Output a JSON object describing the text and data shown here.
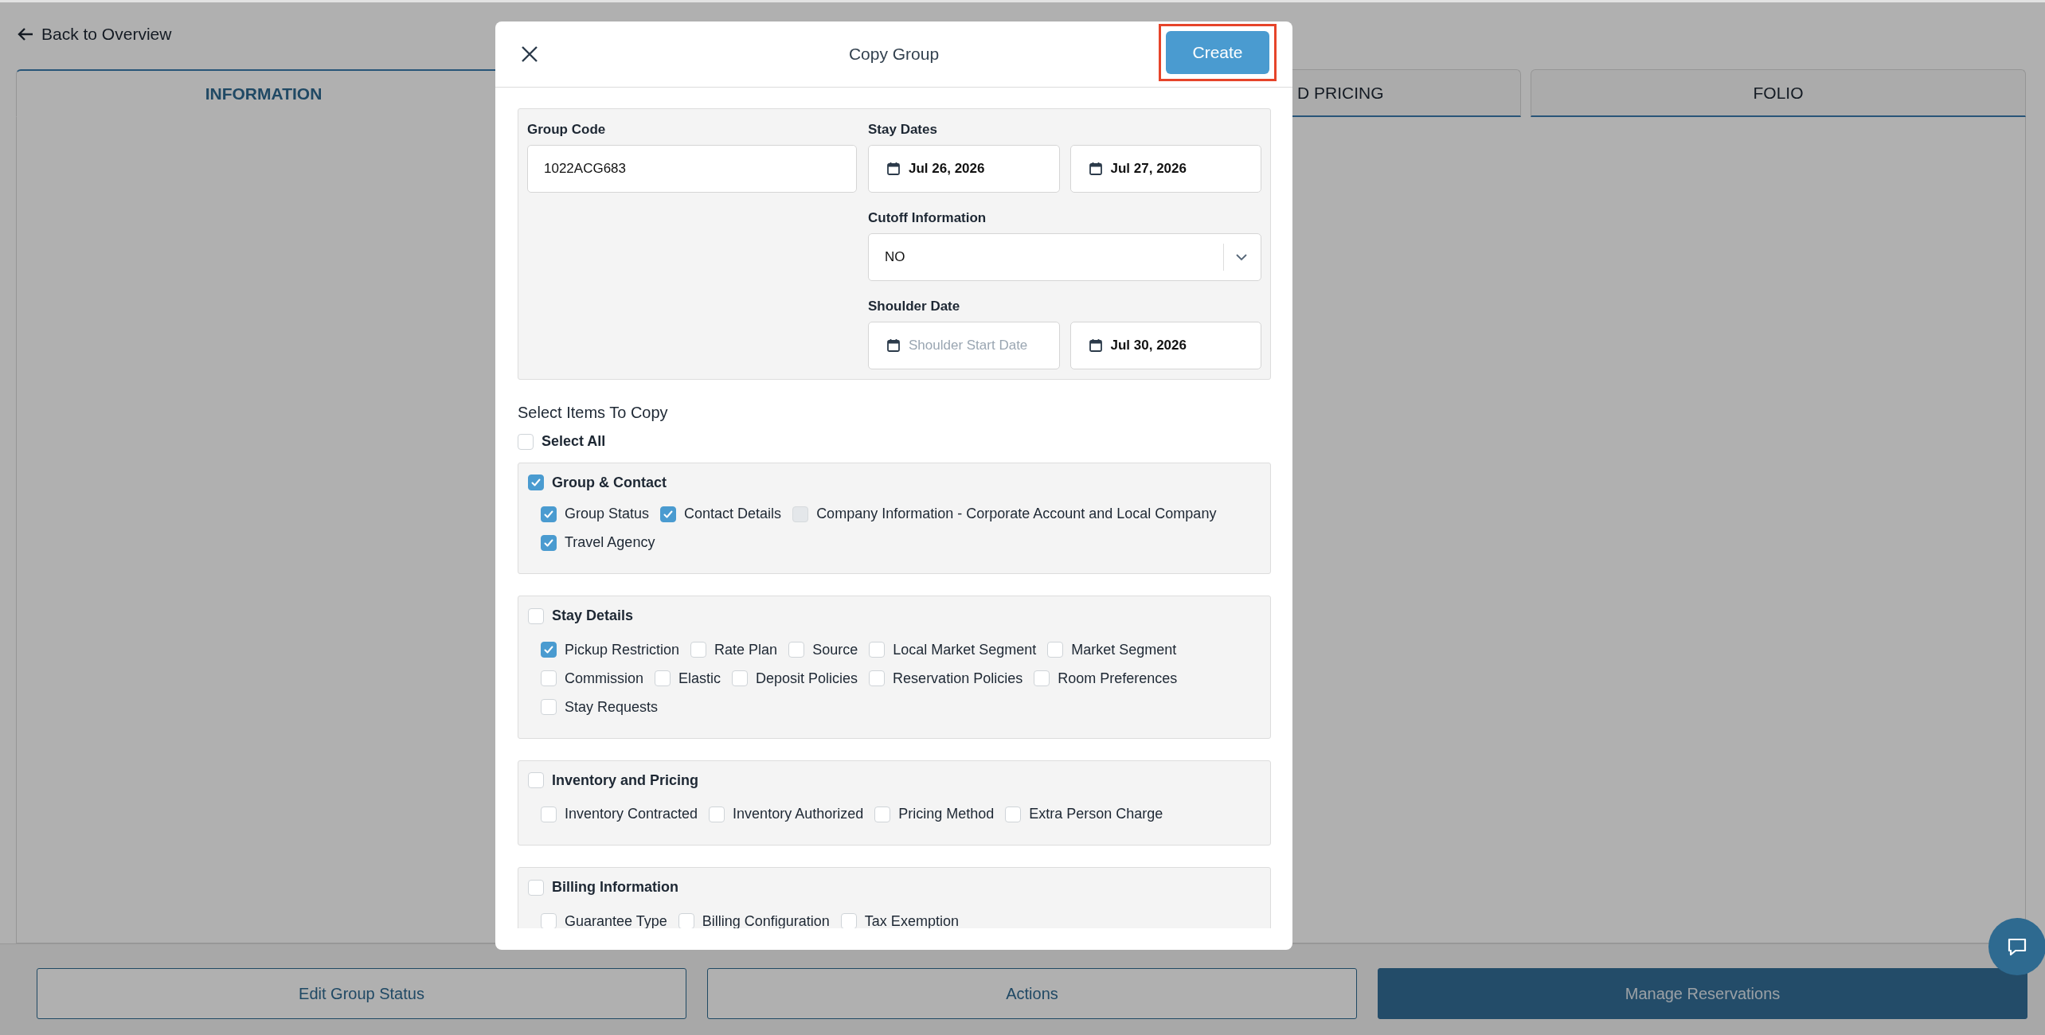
{
  "page": {
    "back_link": "Back to Overview",
    "tabs": [
      {
        "label": "INFORMATION",
        "selected": true,
        "kind": "full"
      },
      {
        "label": "D PRICING",
        "selected": false,
        "kind": "cut"
      },
      {
        "label": "FOLIO",
        "selected": false,
        "kind": "full"
      }
    ],
    "actions": [
      {
        "label": "Edit Group Status",
        "kind": "outline"
      },
      {
        "label": "Actions",
        "kind": "outline"
      },
      {
        "label": "Manage Reservations",
        "kind": "primary"
      }
    ]
  },
  "dialog": {
    "title": "Copy Group",
    "create_button": {
      "label": "Create",
      "highlighted": true
    },
    "group_code": {
      "label": "Group Code",
      "value": "1022ACG683"
    },
    "stay_dates": {
      "label": "Stay Dates",
      "fields": [
        {
          "value": "Jul 26, 2026"
        },
        {
          "value": "Jul 27, 2026"
        }
      ]
    },
    "cutoff": {
      "label": "Cutoff Information",
      "value": "NO"
    },
    "shoulder_date": {
      "label": "Shoulder Date",
      "fields": [
        {
          "placeholder": "Shoulder Start Date"
        },
        {
          "value": "Jul 30, 2026"
        }
      ]
    },
    "select_heading": "Select Items To Copy",
    "select_all": {
      "label": "Select All",
      "checked": false
    },
    "sections": [
      {
        "label": "Group & Contact",
        "checked": true,
        "items": [
          {
            "label": "Group Status",
            "checked": true,
            "disabled": false
          },
          {
            "label": "Contact Details",
            "checked": true,
            "disabled": false
          },
          {
            "label": "Company Information - Corporate Account and Local Company",
            "checked": false,
            "disabled": true
          },
          {
            "label": "Travel Agency",
            "checked": true,
            "disabled": false
          }
        ]
      },
      {
        "label": "Stay Details",
        "checked": false,
        "items": [
          {
            "label": "Pickup Restriction",
            "checked": true,
            "disabled": false
          },
          {
            "label": "Rate Plan",
            "checked": false,
            "disabled": false
          },
          {
            "label": "Source",
            "checked": false,
            "disabled": false
          },
          {
            "label": "Local Market Segment",
            "checked": false,
            "disabled": false
          },
          {
            "label": "Market Segment",
            "checked": false,
            "disabled": false
          },
          {
            "label": "Commission",
            "checked": false,
            "disabled": false
          },
          {
            "label": "Elastic",
            "checked": false,
            "disabled": false
          },
          {
            "label": "Deposit Policies",
            "checked": false,
            "disabled": false
          },
          {
            "label": "Reservation Policies",
            "checked": false,
            "disabled": false
          },
          {
            "label": "Room Preferences",
            "checked": false,
            "disabled": false
          },
          {
            "label": "Stay Requests",
            "checked": false,
            "disabled": false
          }
        ]
      },
      {
        "label": "Inventory and Pricing",
        "checked": false,
        "items": [
          {
            "label": "Inventory Contracted",
            "checked": false,
            "disabled": false
          },
          {
            "label": "Inventory Authorized",
            "checked": false,
            "disabled": false
          },
          {
            "label": "Pricing Method",
            "checked": false,
            "disabled": false
          },
          {
            "label": "Extra Person Charge",
            "checked": false,
            "disabled": false
          }
        ]
      },
      {
        "label": "Billing Information",
        "checked": false,
        "items": [
          {
            "label": "Guarantee Type",
            "checked": false,
            "disabled": false
          },
          {
            "label": "Billing Configuration",
            "checked": false,
            "disabled": false
          },
          {
            "label": "Tax Exemption",
            "checked": false,
            "disabled": false
          }
        ]
      }
    ]
  }
}
